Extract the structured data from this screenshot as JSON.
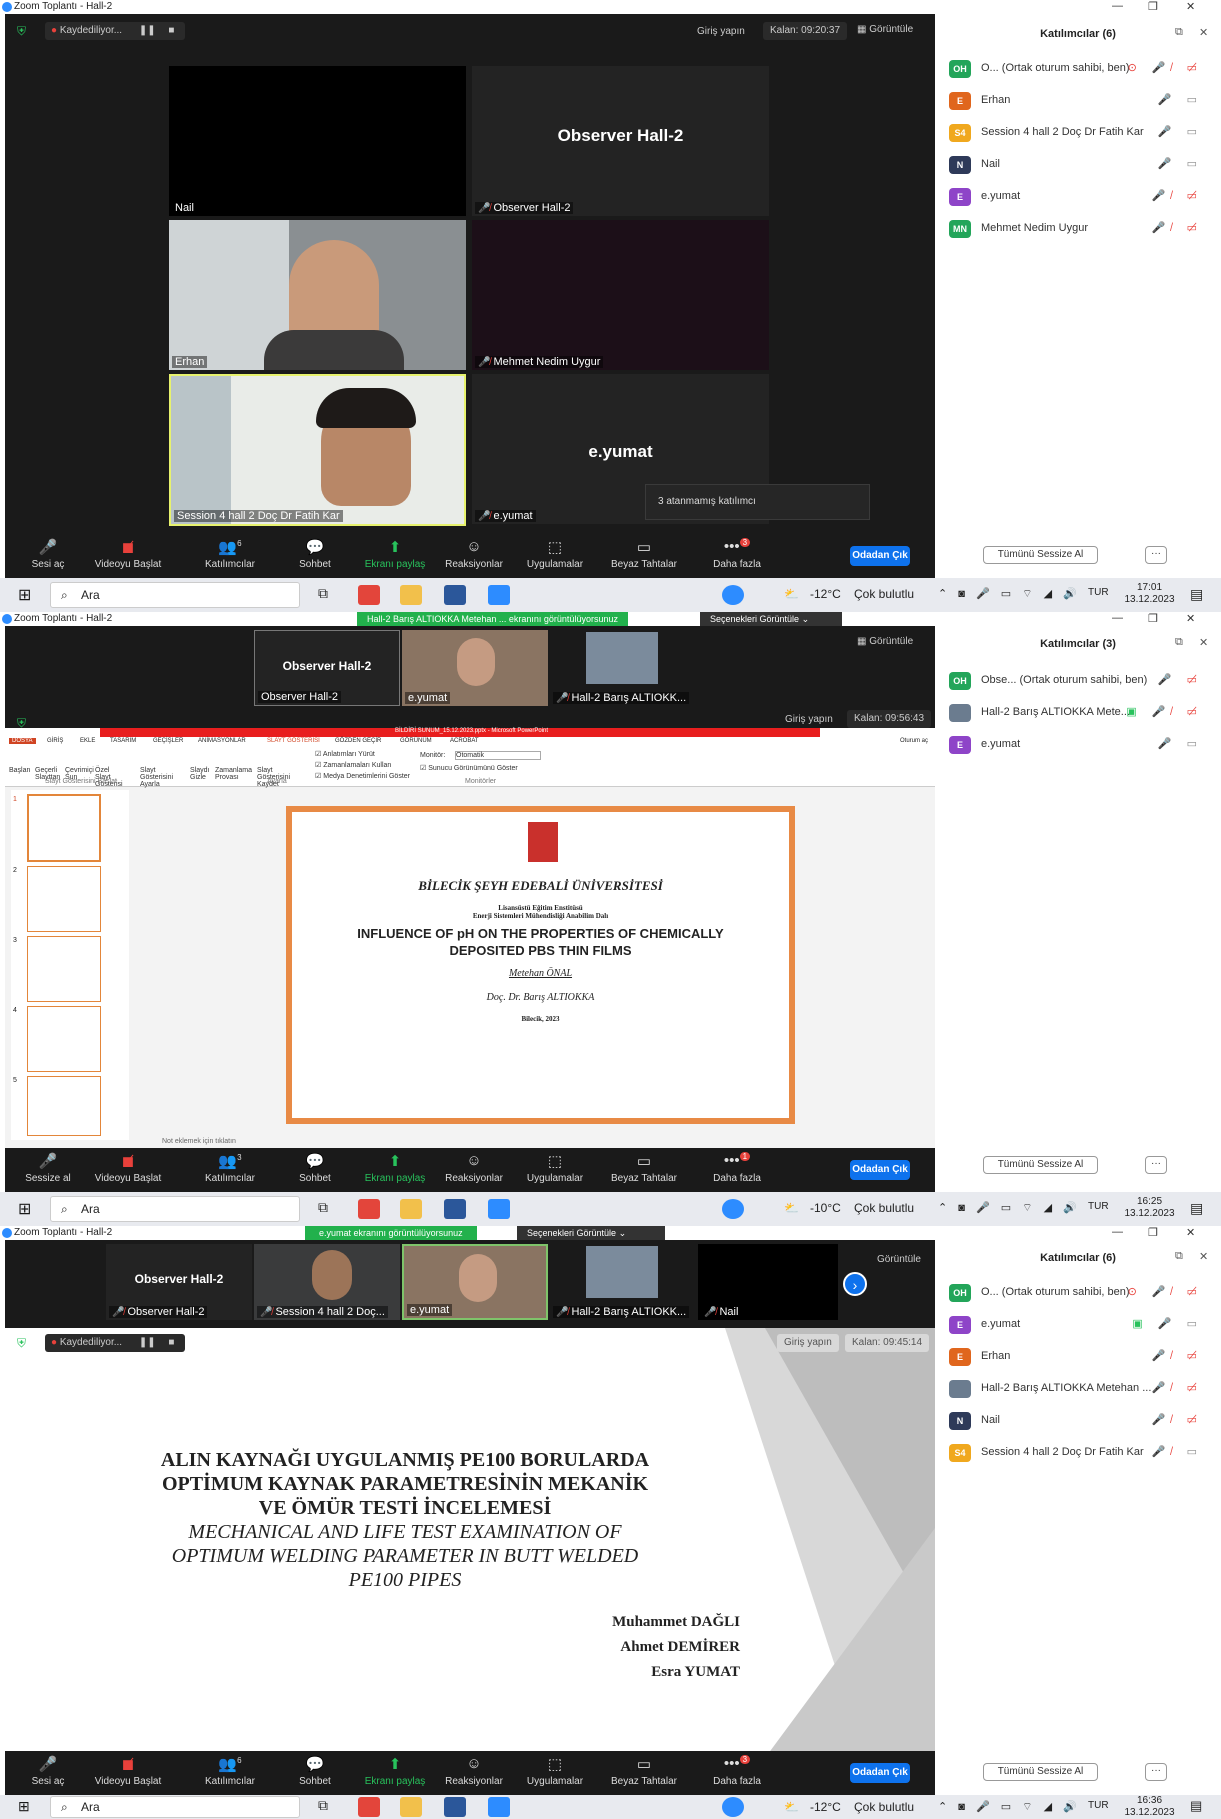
{
  "s1": {
    "app_title": "Zoom Toplantı - Hall-2",
    "recording": "Kaydediliyor...",
    "sign_in": "Giriş yapın",
    "remaining": "Kalan: 09:20:37",
    "view": "Görüntüle",
    "tiles": [
      {
        "name": "Nail"
      },
      {
        "big": "Observer  Hall-2",
        "name": "Observer  Hall-2"
      },
      {
        "name": "Erhan"
      },
      {
        "name": "Mehmet Nedim Uygur"
      },
      {
        "name": "Session 4 hall 2 Doç Dr Fatih Kar"
      },
      {
        "big": "e.yumat",
        "name": "e.yumat"
      }
    ],
    "tooltip": "3 atanmamış katılımcı",
    "toolbar": {
      "mute": "Sesi aç",
      "video": "Videoyu Başlat",
      "participants": "Katılımcılar",
      "participants_count": "6",
      "chat": "Sohbet",
      "share": "Ekranı paylaş",
      "reactions": "Reaksiyonlar",
      "apps": "Uygulamalar",
      "whiteboard": "Beyaz Tahtalar",
      "more": "Daha fazla",
      "more_badge": "3",
      "leave": "Odadan Çık"
    },
    "panel": {
      "title": "Katılımcılar (6)",
      "mute_all": "Tümünü Sessize Al",
      "more": "···",
      "people": [
        {
          "init": "OH",
          "color": "#23a55a",
          "name": "O... (Ortak oturum sahibi, ben)"
        },
        {
          "init": "E",
          "color": "#e0661d",
          "name": "Erhan"
        },
        {
          "init": "S4",
          "color": "#f0a81e",
          "name": "Session 4 hall 2 Doç Dr Fatih Kar"
        },
        {
          "init": "N",
          "color": "#2e3a59",
          "name": "Nail"
        },
        {
          "init": "E",
          "color": "#8e44c8",
          "name": "e.yumat"
        },
        {
          "init": "MN",
          "color": "#23a55a",
          "name": "Mehmet Nedim Uygur"
        }
      ]
    },
    "taskbar": {
      "search": "Ara",
      "temp": "-12°C",
      "weather": "Çok bulutlu",
      "lang": "TUR",
      "time": "17:01",
      "date": "13.12.2023"
    }
  },
  "s2": {
    "app_title": "Zoom Toplantı - Hall-2",
    "share_banner": "Hall-2 Barış ALTIOKKA Metehan ... ekranını görüntülüyorsunuz",
    "view_options": "Seçenekleri Görüntüle",
    "view": "Görüntüle",
    "sign_in": "Giriş yapın",
    "remaining": "Kalan: 09:56:43",
    "strip": [
      {
        "big": "Observer  Hall-2",
        "name": "Observer  Hall-2"
      },
      {
        "name": "e.yumat"
      },
      {
        "name": "Hall-2 Barış ALTIOKK..."
      }
    ],
    "ppt": {
      "file": "BİLDİRİ SUNUM_15.12.2023.pptx - Microsoft PowerPoint",
      "tabs": [
        "DOSYA",
        "GİRİŞ",
        "EKLE",
        "TASARIM",
        "GEÇİŞLER",
        "ANİMASYONLAR",
        "SLAYT GÖSTERİSİ",
        "GÖZDEN GEÇİR",
        "GÖRÜNÜM",
        "ACROBAT"
      ],
      "sign": "Oturum aç",
      "ribbon": [
        "Başlan",
        "Geçerli Slayttan",
        "Çevrimiçi Sun",
        "Özel Slayt Gösterisi",
        "Slayt Gösterisini Ayarla",
        "Slaydı Gizle",
        "Zamanlama Provası",
        "Slayt Gösterisini Kaydet"
      ],
      "checks": [
        "Anlatımları Yürüt",
        "Zamanlamaları Kullan",
        "Medya Denetimlerini Göster"
      ],
      "monitor_label": "Monitör:",
      "monitor_value": "Otomatik",
      "presenter": "Sunucu Görünümünü Göster",
      "group1": "Slayt Gösterisini Başlat",
      "group2": "Ayarla",
      "group3": "Monitörler",
      "notes": "Not eklemek için tıklatın",
      "slide": {
        "univ": "BİLECİK ŞEYH EDEBALİ ÜNİVERSİTESİ",
        "inst": "Lisansüstü Eğitim Enstitüsü",
        "dept": "Enerji Sistemleri Mühendisliği Anabilim Dalı",
        "title1": "INFLUENCE OF pH ON THE PROPERTIES OF CHEMICALLY",
        "title2": "DEPOSITED PBS THIN FILMS",
        "author": "Metehan ÖNAL",
        "advisor": "Doç. Dr. Barış ALTIOKKA",
        "place": "Bilecik, 2023"
      },
      "thumb_nums": [
        "1",
        "2",
        "3",
        "4",
        "5"
      ]
    },
    "toolbar": {
      "mute": "Sessize al",
      "video": "Videoyu Başlat",
      "participants": "Katılımcılar",
      "participants_count": "3",
      "chat": "Sohbet",
      "share": "Ekranı paylaş",
      "reactions": "Reaksiyonlar",
      "apps": "Uygulamalar",
      "whiteboard": "Beyaz Tahtalar",
      "more": "Daha fazla",
      "more_badge": "1",
      "leave": "Odadan Çık"
    },
    "panel": {
      "title": "Katılımcılar (3)",
      "mute_all": "Tümünü Sessize Al",
      "more": "···",
      "people": [
        {
          "init": "OH",
          "color": "#23a55a",
          "name": "Obse... (Ortak oturum sahibi, ben)"
        },
        {
          "init": "",
          "color": "#6b7c8f",
          "name": "Hall-2 Barış ALTIOKKA Mete..."
        },
        {
          "init": "E",
          "color": "#8e44c8",
          "name": "e.yumat"
        }
      ]
    },
    "taskbar": {
      "search": "Ara",
      "temp": "-10°C",
      "weather": "Çok bulutlu",
      "lang": "TUR",
      "time": "16:25",
      "date": "13.12.2023"
    }
  },
  "s3": {
    "app_title": "Zoom Toplantı - Hall-2",
    "share_banner": "e.yumat ekranını görüntülüyorsunuz",
    "view_options": "Seçenekleri Görüntüle",
    "view": "Görüntüle",
    "recording": "Kaydediliyor...",
    "sign_in": "Giriş yapın",
    "remaining": "Kalan: 09:45:14",
    "strip": [
      {
        "big": "Observer  Hall-2",
        "name": "Observer  Hall-2"
      },
      {
        "name": "Session 4 hall 2 Doç..."
      },
      {
        "name": "e.yumat"
      },
      {
        "name": "Hall-2 Barış ALTIOKK..."
      },
      {
        "name": "Nail"
      }
    ],
    "slide": {
      "tr1": "ALIN KAYNAĞI UYGULANMIŞ PE100 BORULARDA",
      "tr2": "OPTİMUM KAYNAK PARAMETRESİNİN MEKANİK",
      "tr3": "VE ÖMÜR TESTİ İNCELEMESİ",
      "en1": "MECHANICAL AND LIFE TEST EXAMINATION OF",
      "en2": "OPTIMUM WELDING PARAMETER IN BUTT WELDED",
      "en3": "PE100 PIPES",
      "a1": "Muhammet DAĞLI",
      "a2": "Ahmet DEMİRER",
      "a3": "Esra YUMAT"
    },
    "toolbar": {
      "mute": "Sesi aç",
      "video": "Videoyu Başlat",
      "participants": "Katılımcılar",
      "participants_count": "6",
      "chat": "Sohbet",
      "share": "Ekranı paylaş",
      "reactions": "Reaksiyonlar",
      "apps": "Uygulamalar",
      "whiteboard": "Beyaz Tahtalar",
      "more": "Daha fazla",
      "more_badge": "3",
      "leave": "Odadan Çık"
    },
    "panel": {
      "title": "Katılımcılar (6)",
      "mute_all": "Tümünü Sessize Al",
      "more": "···",
      "people": [
        {
          "init": "OH",
          "color": "#23a55a",
          "name": "O... (Ortak oturum sahibi, ben)"
        },
        {
          "init": "E",
          "color": "#8e44c8",
          "name": "e.yumat"
        },
        {
          "init": "E",
          "color": "#e0661d",
          "name": "Erhan"
        },
        {
          "init": "",
          "color": "#6b7c8f",
          "name": "Hall-2 Barış ALTIOKKA Metehan ..."
        },
        {
          "init": "N",
          "color": "#2e3a59",
          "name": "Nail"
        },
        {
          "init": "S4",
          "color": "#f0a81e",
          "name": "Session 4 hall 2 Doç Dr Fatih Kar"
        }
      ]
    },
    "taskbar": {
      "search": "Ara",
      "temp": "-12°C",
      "weather": "Çok bulutlu",
      "lang": "TUR",
      "time": "16:36",
      "date": "13.12.2023"
    }
  }
}
